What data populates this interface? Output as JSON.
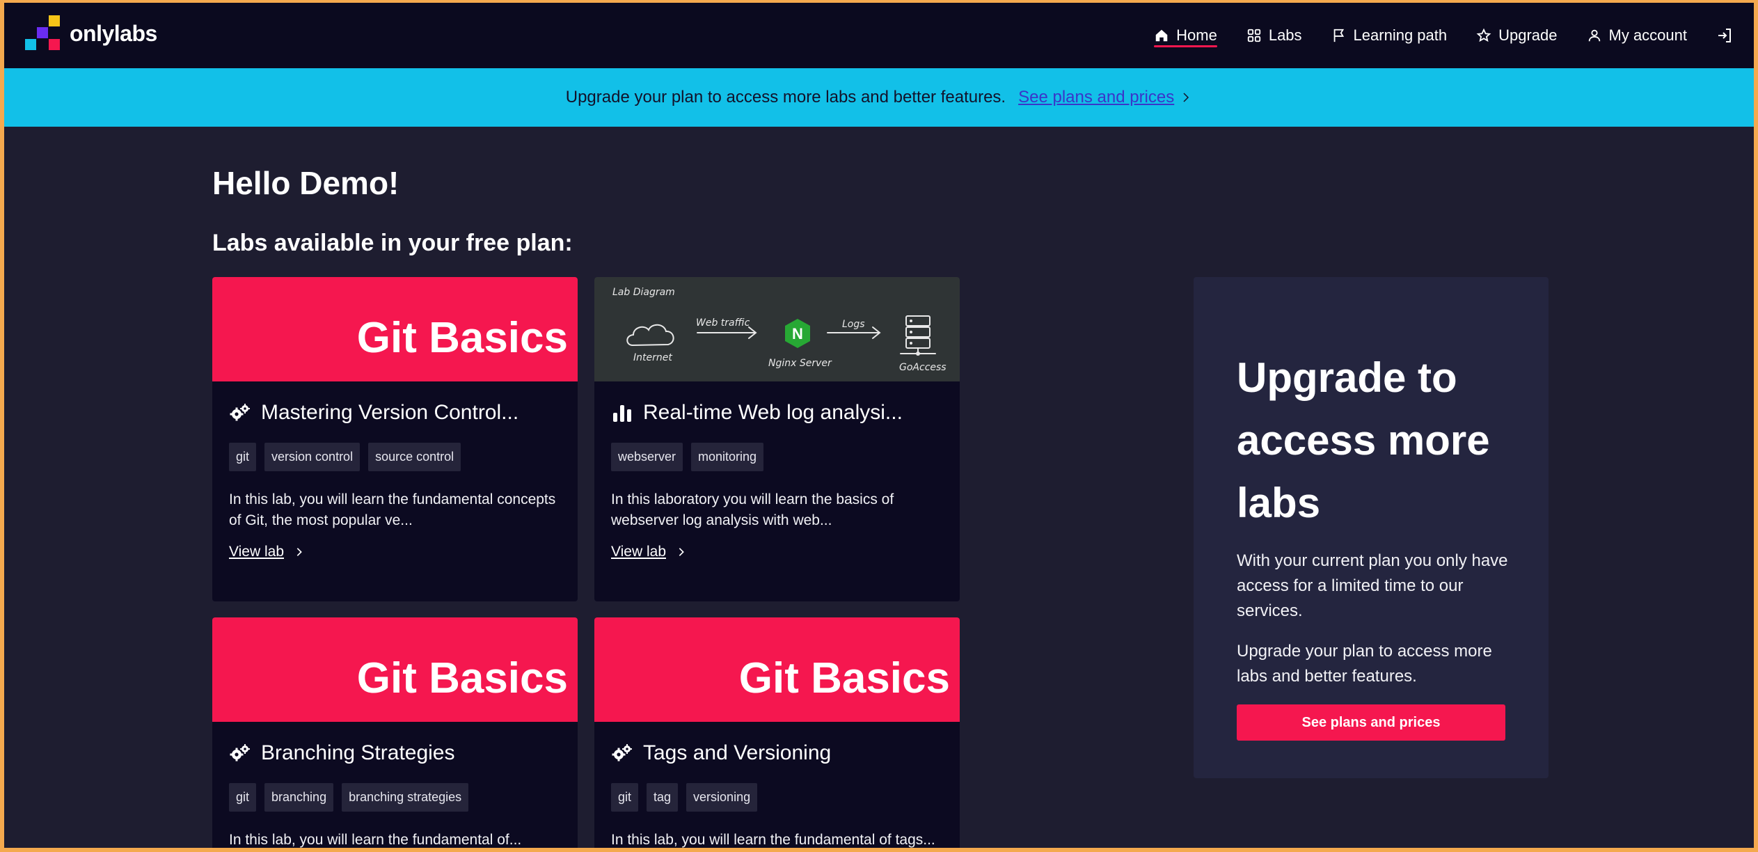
{
  "brand": {
    "name": "onlylabs"
  },
  "nav": {
    "home": "Home",
    "labs": "Labs",
    "learning_path": "Learning path",
    "upgrade": "Upgrade",
    "my_account": "My account"
  },
  "banner": {
    "text": "Upgrade your plan to access more labs and better features.",
    "link": "See plans and prices"
  },
  "main": {
    "greeting": "Hello Demo!",
    "subtitle": "Labs available in your free plan:",
    "labs": [
      {
        "banner_text": "Git Basics",
        "icon": "gears-icon",
        "title": "Mastering Version Control...",
        "tags": [
          "git",
          "version control",
          "source control"
        ],
        "description": "In this lab, you will learn the fundamental concepts of Git, the most popular ve...",
        "link": "View lab"
      },
      {
        "banner_diagram": {
          "heading": "Lab Diagram",
          "nodes": [
            "Internet",
            "Nginx Server",
            "GoAccess"
          ],
          "edges": [
            "Web traffic",
            "Logs"
          ],
          "nginx_letter": "N"
        },
        "icon": "bar-chart-icon",
        "title": "Real-time Web log analysi...",
        "tags": [
          "webserver",
          "monitoring"
        ],
        "description": "In this laboratory you will learn the basics of webserver log analysis with web...",
        "link": "View lab"
      },
      {
        "banner_text": "Git Basics",
        "icon": "gears-icon",
        "title": "Branching Strategies",
        "tags": [
          "git",
          "branching",
          "branching strategies"
        ],
        "description": "In this lab, you will learn the fundamental of..."
      },
      {
        "banner_text": "Git Basics",
        "icon": "gears-icon",
        "title": "Tags and Versioning",
        "tags": [
          "git",
          "tag",
          "versioning"
        ],
        "description": "In this lab, you will learn the fundamental of tags..."
      }
    ]
  },
  "upgrade_panel": {
    "heading": "Upgrade to access more labs",
    "text1": "With your current plan you only have access for a limited time to our services.",
    "text2": "Upgrade your plan to access more labs and better features.",
    "button": "See plans and prices"
  },
  "colors": {
    "nav_bg": "#0b0a1f",
    "page_bg": "#1e1d30",
    "banner_bg": "#12c0e8",
    "accent": "#f5174f",
    "card_bg": "#0c0a21",
    "panel_bg": "#24253f",
    "outer_border": "#f4a94e"
  }
}
